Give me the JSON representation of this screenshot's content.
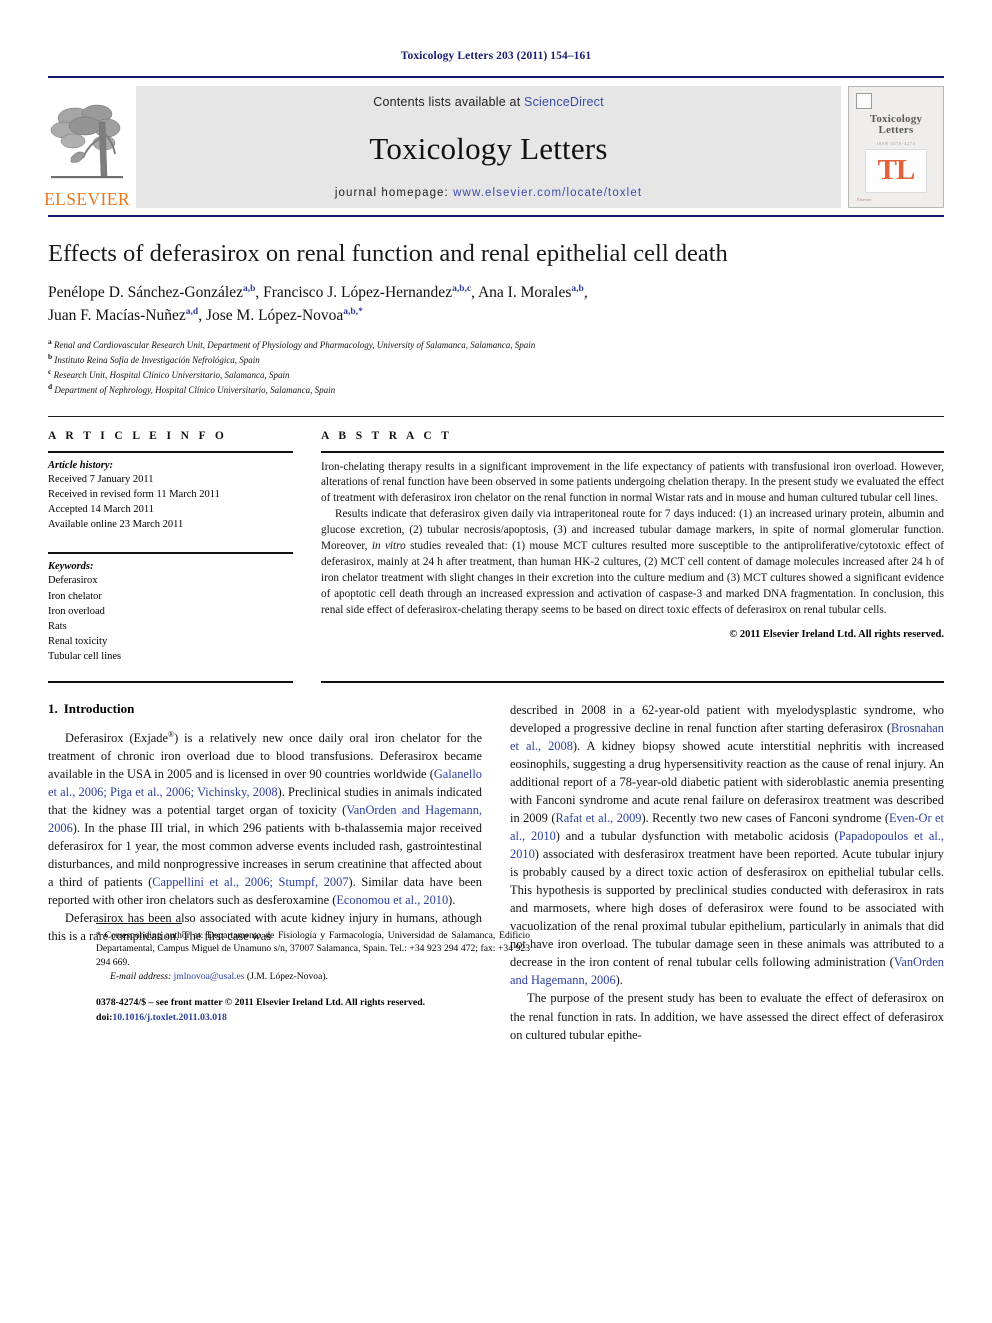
{
  "running_head": "Toxicology Letters 203 (2011) 154–161",
  "masthead": {
    "contents_prefix": "Contents lists available at ",
    "sciencedirect": "ScienceDirect",
    "journal_name": "Toxicology Letters",
    "homepage_prefix": "journal homepage: ",
    "homepage_url": "www.elsevier.com/locate/toxlet",
    "publisher_wordmark": "ELSEVIER",
    "cover": {
      "title_line1": "Toxicology",
      "title_line2": "Letters",
      "subtitle": "ISSN 0378-4274",
      "monogram": "TL",
      "footer_mark": "Elsevier"
    },
    "accent_orange": "#E87722",
    "link_blue": "#3b4ba8",
    "rule_navy": "#16186b"
  },
  "article": {
    "title": "Effects of deferasirox on renal function and renal epithelial cell death",
    "authors_line1_pre": "Penélope D. Sánchez-González",
    "authors": [
      {
        "name": "Penélope D. Sánchez-González",
        "sup": "a,b",
        "sep": ", "
      },
      {
        "name": "Francisco J. López-Hernandez",
        "sup": "a,b,c",
        "sep": ", "
      },
      {
        "name": "Ana I. Morales",
        "sup": "a,b",
        "sep": ","
      },
      {
        "name": "Juan F. Macías-Nuñez",
        "sup": "a,d",
        "sep": ", "
      },
      {
        "name": "Jose M. López-Novoa",
        "sup": "a,b,*",
        "sep": ""
      }
    ],
    "affiliations": [
      {
        "key": "a",
        "text": "Renal and Cardiovascular Research Unit, Department of Physiology and Pharmacology, University of Salamanca, Salamanca, Spain"
      },
      {
        "key": "b",
        "text": "Instituto Reina Sofía de Investigación Nefrológica, Spain"
      },
      {
        "key": "c",
        "text": "Research Unit, Hospital Clínico Universitario, Salamanca, Spain"
      },
      {
        "key": "d",
        "text": "Department of Nephrology, Hospital Clínico Universitario, Salamanca, Spain"
      }
    ]
  },
  "article_info": {
    "heading": "A R T I C L E   I N F O",
    "history_label": "Article history:",
    "history": [
      "Received 7 January 2011",
      "Received in revised form 11 March 2011",
      "Accepted 14 March 2011",
      "Available online 23 March 2011"
    ],
    "keywords_label": "Keywords:",
    "keywords": [
      "Deferasirox",
      "Iron chelator",
      "Iron overload",
      "Rats",
      "Renal toxicity",
      "Tubular cell lines"
    ]
  },
  "abstract": {
    "heading": "A B S T R A C T",
    "paragraph1": "Iron-chelating therapy results in a significant improvement in the life expectancy of patients with transfusional iron overload. However, alterations of renal function have been observed in some patients undergoing chelation therapy. In the present study we evaluated the effect of treatment with deferasirox iron chelator on the renal function in normal Wistar rats and in mouse and human cultured tubular cell lines.",
    "paragraph2_a": "Results indicate that deferasirox given daily via intraperitoneal route for 7 days induced: (1) an increased urinary protein, albumin and glucose excretion, (2) tubular necrosis/apoptosis, (3) and increased tubular damage markers, in spite of normal glomerular function. Moreover, ",
    "paragraph2_em": "in vitro",
    "paragraph2_b": " studies revealed that: (1) mouse MCT cultures resulted more susceptible to the antiproliferative/cytotoxic effect of deferasirox, mainly at 24 h after treatment, than human HK-2 cultures, (2) MCT cell content of damage molecules increased after 24 h of iron chelator treatment with slight changes in their excretion into the culture medium and (3) MCT cultures showed a significant evidence of apoptotic cell death through an increased expression and activation of caspase-3 and marked DNA fragmentation. In conclusion, this renal side effect of deferasirox-chelating therapy seems to be based on direct toxic effects of deferasirox on renal tubular cells.",
    "copyright": "© 2011 Elsevier Ireland Ltd. All rights reserved."
  },
  "body": {
    "section1_num": "1.",
    "section1_title": "Introduction",
    "left_p1_a": "Deferasirox (Exjade",
    "left_p1_reg": "®",
    "left_p1_b": ") is a relatively new once daily oral iron chelator for the treatment of chronic iron overload due to blood transfusions. Deferasirox became available in the USA in 2005 and is licensed in over 90 countries worldwide (",
    "left_p1_ref1": "Galanello et al., 2006; Piga et al., 2006; Vichinsky, 2008",
    "left_p1_c": "). Preclinical studies in animals indicated that the kidney was a potential target organ of toxicity (",
    "left_p1_ref2": "VanOrden and Hagemann, 2006",
    "left_p1_d": "). In the phase III trial, in which 296 patients with b-thalassemia major received deferasirox for 1 year, the most common adverse events included rash, gastrointestinal disturbances, and mild nonprogressive increases in serum creatinine that affected about a third of patients (",
    "left_p1_ref3": "Cappellini et al., 2006; Stumpf, 2007",
    "left_p1_e": "). Similar data have been reported with other iron chelators such as desferoxamine (",
    "left_p1_ref4": "Economou et al., 2010",
    "left_p1_f": ").",
    "left_p2_a": "Deferasirox has been also associated with acute kidney injury in humans, athough this is a rare complication. The first case was",
    "right_p1_a": "described in 2008 in a 62-year-old patient with myelodysplastic syndrome, who developed a progressive decline in renal function after starting deferasirox (",
    "right_p1_ref1": "Brosnahan et al., 2008",
    "right_p1_b": "). A kidney biopsy showed acute interstitial nephritis with increased eosinophils, suggesting a drug hypersensitivity reaction as the cause of renal injury. An additional report of a 78-year-old diabetic patient with sideroblastic anemia presenting with Fanconi syndrome and acute renal failure on deferasirox treatment was described in 2009 (",
    "right_p1_ref2": "Rafat et al., 2009",
    "right_p1_c": "). Recently two new cases of Fanconi syndrome (",
    "right_p1_ref3": "Even-Or et al., 2010",
    "right_p1_d": ") and a tubular dysfunction with metabolic acidosis (",
    "right_p1_ref4": "Papadopoulos et al., 2010",
    "right_p1_e": ") associated with desferasirox treatment have been reported. Acute tubular injury is probably caused by a direct toxic action of desferasirox on epithelial tubular cells. This hypothesis is supported by preclinical studies conducted with deferasirox in rats and marmosets, where high doses of deferasirox were found to be associated with vacuolization of the renal proximal tubular epithelium, particularly in animals that did not have iron overload. The tubular damage seen in these animals was attributed to a decrease in the iron content of renal tubular cells following administration (",
    "right_p1_ref5": "VanOrden and Hagemann, 2006",
    "right_p1_f": ").",
    "right_p2": "The purpose of the present study has been to evaluate the effect of deferasirox on the renal function in rats. In addition, we have assessed the direct effect of deferasirox on cultured tubular epithe-"
  },
  "footnotes": {
    "corresponding_star": "*",
    "corresponding_text": " Corresponding author at: Departamento de Fisiología y Farmacología, Universidad de Salamanca, Edificio Departamental, Campus Miguel de Unamuno s/n, 37007 Salamanca, Spain. Tel.: +34 923 294 472; fax: +34 923 294 669.",
    "email_label": "E-mail address:",
    "email": "jmlnovoa@usal.es",
    "email_owner": " (J.M. López-Novoa).",
    "imprint_line1": "0378-4274/$ – see front matter © 2011 Elsevier Ireland Ltd. All rights reserved.",
    "doi_label": "doi:",
    "doi_value": "10.1016/j.toxlet.2011.03.018"
  }
}
